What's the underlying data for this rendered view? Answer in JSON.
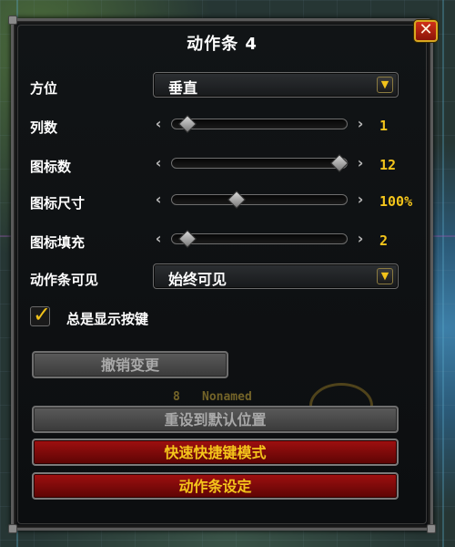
{
  "window": {
    "title": "动作条 4",
    "close_glyph": "✕"
  },
  "orientation": {
    "label": "方位",
    "selected": "垂直",
    "arrow_icon": "chevron-down-icon"
  },
  "sliders": [
    {
      "label": "列数",
      "value_text": "1",
      "level": 0.05
    },
    {
      "label": "图标数",
      "value_text": "12",
      "level": 1.0
    },
    {
      "label": "图标尺寸",
      "value_text": "100%",
      "level": 0.36
    },
    {
      "label": "图标填充",
      "value_text": "2",
      "level": 0.05
    }
  ],
  "visibility": {
    "label": "动作条可见",
    "selected": "始终可见"
  },
  "always_show_keys": {
    "label": "总是显示按键",
    "checked": true
  },
  "buttons": {
    "undo": "撤销变更",
    "reset": "重设到默认位置",
    "quick_keybind": "快速快捷键模式",
    "bar_settings": "动作条设定"
  },
  "background_nameplate": {
    "level": "8",
    "name": "Nonamed"
  },
  "colors": {
    "value_gold": "#f4c51b",
    "button_red": "#a01010"
  }
}
